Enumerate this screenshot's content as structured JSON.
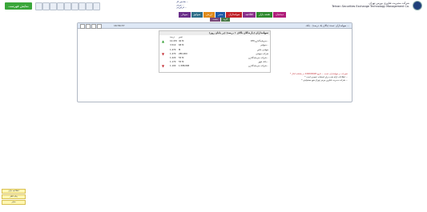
{
  "top": {
    "login_label": "نمایش فهرست",
    "ticker_lines": [
      "شاخص کل ...",
      "بورس ...",
      "فرابورس ..."
    ],
    "brand_fa": "شرکت مدیریت فناوری بورس تهران",
    "brand_en": "Tehran Securities Exchange Technology Management Co."
  },
  "tabs": [
    {
      "label": "دیده‌بان",
      "color": "#b01e7a"
    },
    {
      "label": "نقشه بازار",
      "color": "#2f8a2f"
    },
    {
      "label": "اطلاعیه",
      "color": "#8a2f8a"
    },
    {
      "label": "سهامداران",
      "color": "#c0222a"
    },
    {
      "label": "مدیر",
      "color": "#1f5aa8"
    },
    {
      "label": "ارزش",
      "color": "#e08a1a"
    },
    {
      "label": "سوابق",
      "color": "#2f6f8a"
    },
    {
      "label": "نمودار",
      "color": "#6a2f8a"
    }
  ],
  "subtabs": [
    {
      "label": "گروه",
      "color": "#4a7a4a"
    },
    {
      "label": "صنعت",
      "color": "#7a4a7a"
    }
  ],
  "panel": {
    "title": "سهامداران عمده (بالای یک درصد) - بانک ...",
    "time": "16:56:37"
  },
  "inner": {
    "title": "سهامداران (دارندگان بالای ۱ درصد) (در پایان روز)",
    "col_vol": "تغییر",
    "col_price": "درصد",
    "rows": [
      {
        "desc": "OTC‌سرمایه‌گذاری...",
        "vol": "40 M",
        "price": "10.470",
        "dir": "up"
      },
      {
        "desc": "سهامی...",
        "vol": "68 M",
        "price": "3.510",
        "dir": "none"
      },
      {
        "desc": "سهامی خاص",
        "vol": "M",
        "price": "1.470",
        "dir": "none"
      },
      {
        "desc": "شرکت سهامی",
        "vol": "280,000",
        "price": "1.470",
        "dir": "down"
      },
      {
        "desc": "شرکت سرمایه‌گذاری...",
        "vol": "55 M",
        "price": "1.220",
        "dir": "none"
      },
      {
        "desc": "بانک شهر...",
        "vol": "55 M",
        "price": "1.170",
        "dir": "none"
      },
      {
        "desc": "شرکت سرمایه‌گذاری...",
        "vol": "1,588,808",
        "price": "1.100",
        "dir": "down"
      }
    ]
  },
  "notes": {
    "red": "* تغییرات در سهامداران عمده ... تاریخ 1402/04/26 در سامانه کدال",
    "blk1": "* اطلاعات ارائه شده برای استفاده عمومی است ...",
    "blk2": "* شرکت مدیریت فناوری بورس تهران هیچ مسئولیتی ..."
  },
  "legend": [
    "اطلاعیه بازار",
    "پیام ناظر",
    "سایر"
  ]
}
